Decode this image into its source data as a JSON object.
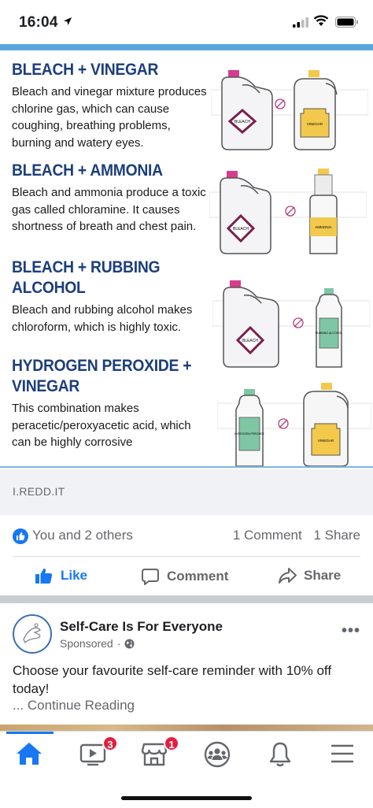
{
  "status_bar": {
    "time": "16:04"
  },
  "infographic": {
    "sections": [
      {
        "title": "BLEACH + VINEGAR",
        "body": "Bleach and vinegar mixture produces chlorine gas, which can cause coughing, breathing problems, burning and watery eyes.",
        "label_left": "BLEACH",
        "label_right": "VINEGAR"
      },
      {
        "title": "BLEACH + AMMONIA",
        "body": "Bleach and ammonia produce a toxic gas called chloramine. It causes shortness of breath and chest pain.",
        "label_left": "BLEACH",
        "label_right": "AMMONIA"
      },
      {
        "title_line1": "BLEACH + RUBBING",
        "title_line2": "ALCOHOL",
        "body": "Bleach and rubbing alcohol makes chloroform, which is highly toxic.",
        "label_left": "BLEACH",
        "label_right": "RUBBING ALCOHOL"
      },
      {
        "title_line1": "HYDROGEN PEROXIDE +",
        "title_line2": "VINEGAR",
        "body": "This combination makes peracetic/peroxyacetic acid, which can be highly corrosive",
        "label_left": "HYDROGEN PEROXIDE",
        "label_right": "VINEGAR"
      }
    ]
  },
  "link_preview": {
    "domain": "I.REDD.IT"
  },
  "reactions": {
    "summary": "You and 2 others",
    "comments": "1 Comment",
    "shares": "1 Share"
  },
  "actions": {
    "like": "Like",
    "comment": "Comment",
    "share": "Share"
  },
  "sponsored_post": {
    "page_name": "Self-Care Is For Everyone",
    "sponsored_label": "Sponsored",
    "text": "Choose your favourite self-care reminder with 10% off today!",
    "continue": "... Continue Reading"
  },
  "tabbar": {
    "items": [
      {
        "name": "home",
        "active": true
      },
      {
        "name": "watch",
        "badge": "3"
      },
      {
        "name": "marketplace",
        "badge": "1"
      },
      {
        "name": "groups"
      },
      {
        "name": "notifications"
      },
      {
        "name": "menu"
      }
    ]
  },
  "colors": {
    "accent": "#1877f2",
    "title_blue": "#1d3f7a",
    "badge_red": "#e41e3f"
  }
}
